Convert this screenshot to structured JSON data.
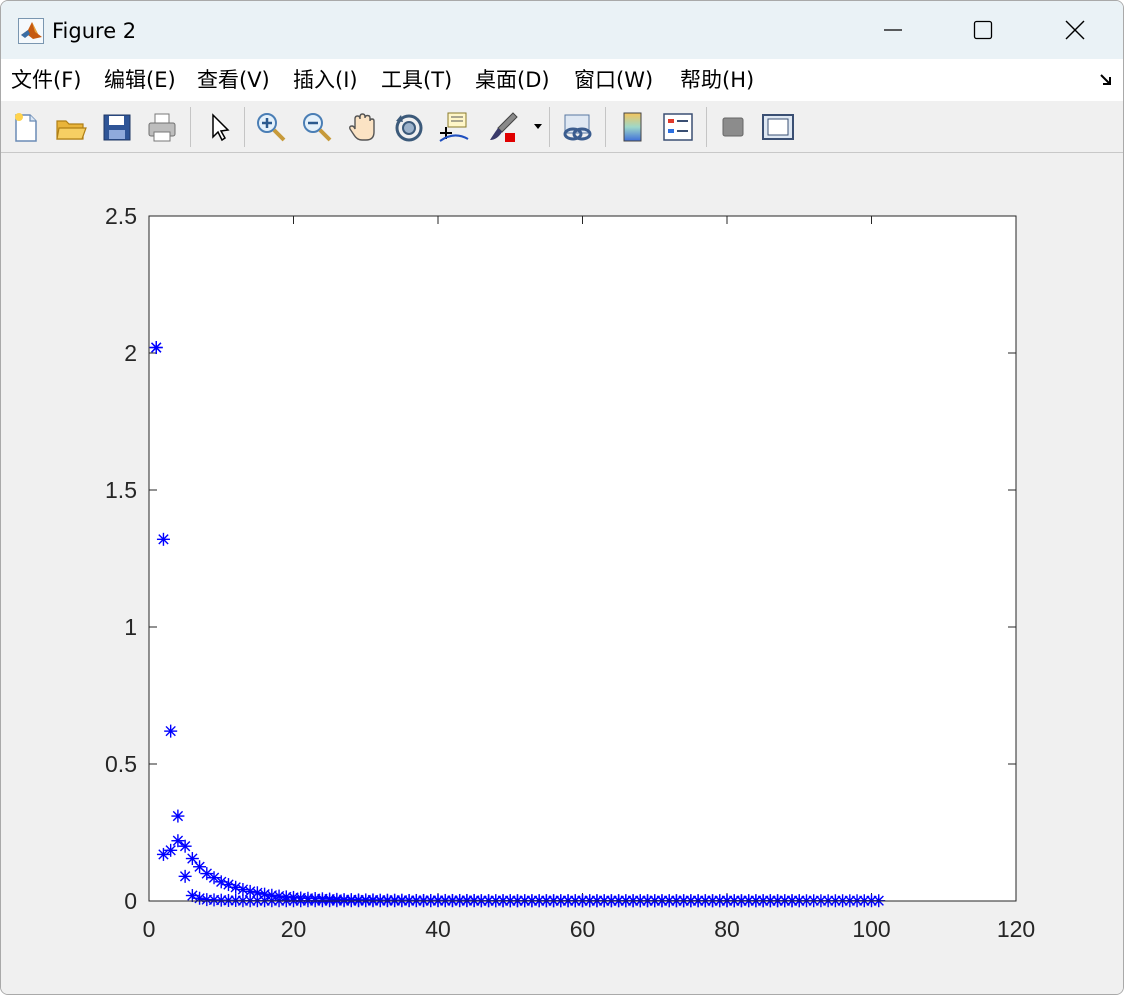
{
  "window": {
    "title": "Figure 2",
    "controls": {
      "minimize": "minimize",
      "maximize": "maximize",
      "close": "close"
    }
  },
  "menu": [
    {
      "label": "文件(F)"
    },
    {
      "label": "编辑(E)"
    },
    {
      "label": "查看(V)"
    },
    {
      "label": "插入(I)"
    },
    {
      "label": "工具(T)"
    },
    {
      "label": "桌面(D)"
    },
    {
      "label": "窗口(W)"
    },
    {
      "label": "帮助(H)"
    }
  ],
  "toolbar": {
    "icons": [
      "new-figure-icon",
      "open-file-icon",
      "save-icon",
      "print-icon",
      "edit-plot-arrow-icon",
      "zoom-in-icon",
      "zoom-out-icon",
      "pan-hand-icon",
      "rotate-3d-icon",
      "data-cursor-icon",
      "brush-icon",
      "brush-dropdown-icon",
      "link-plot-icon",
      "colorbar-icon",
      "legend-icon",
      "hide-plot-tools-icon",
      "show-plot-tools-icon"
    ]
  },
  "chart_data": {
    "type": "scatter",
    "marker": "*",
    "color": "#0000ff",
    "xlim": [
      0,
      120
    ],
    "ylim": [
      0,
      2.5
    ],
    "xticks": [
      "0",
      "20",
      "40",
      "60",
      "80",
      "100",
      "120"
    ],
    "yticks": [
      "0",
      "0.5",
      "1",
      "1.5",
      "2",
      "2.5"
    ],
    "xtick_values": [
      0,
      20,
      40,
      60,
      80,
      100,
      120
    ],
    "ytick_values": [
      0,
      0.5,
      1,
      1.5,
      2,
      2.5
    ],
    "series": [
      {
        "x": [
          1,
          2,
          3,
          4,
          5,
          6,
          7,
          8,
          9,
          10,
          11,
          12,
          13,
          14,
          15,
          16,
          17,
          18,
          19,
          20,
          21,
          22,
          23,
          24,
          25,
          26,
          27,
          28,
          29,
          30,
          31,
          32,
          33,
          34,
          35,
          36,
          37,
          38,
          39,
          40,
          41,
          42,
          43,
          44,
          45,
          46,
          47,
          48,
          49,
          50,
          51,
          52,
          53,
          54,
          55,
          56,
          57,
          58,
          59,
          60,
          61,
          62,
          63,
          64,
          65,
          66,
          67,
          68,
          69,
          70,
          71,
          72,
          73,
          74,
          75,
          76,
          77,
          78,
          79,
          80,
          81,
          82,
          83,
          84,
          85,
          86,
          87,
          88,
          89,
          90,
          91,
          92,
          93,
          94,
          95,
          96,
          97,
          98,
          99,
          100,
          101
        ],
        "y": [
          2.02,
          1.32,
          0.62,
          0.31,
          0.2,
          0.155,
          0.125,
          0.1,
          0.085,
          0.07,
          0.06,
          0.05,
          0.042,
          0.035,
          0.03,
          0.025,
          0.021,
          0.018,
          0.015,
          0.013,
          0.011,
          0.01,
          0.009,
          0.008,
          0.007,
          0.006,
          0.005,
          0.005,
          0.004,
          0.004,
          0.004,
          0.003,
          0.003,
          0.003,
          0.003,
          0.002,
          0.002,
          0.002,
          0.002,
          0.002,
          0.002,
          0.002,
          0.002,
          0.002,
          0.002,
          0.001,
          0.001,
          0.001,
          0.001,
          0.001,
          0.001,
          0.001,
          0.001,
          0.001,
          0.001,
          0.001,
          0.001,
          0.001,
          0.001,
          0.001,
          0.001,
          0.001,
          0.001,
          0.001,
          0.001,
          0.001,
          0.001,
          0.001,
          0.001,
          0.001,
          0.001,
          0.001,
          0.001,
          0.001,
          0.001,
          0.001,
          0.001,
          0.001,
          0.001,
          0.001,
          0.001,
          0.001,
          0.001,
          0.001,
          0.001,
          0.001,
          0.001,
          0.001,
          0.001,
          0.001,
          0.001,
          0.001,
          0.001,
          0.001,
          0.001,
          0.001,
          0.001,
          0.001,
          0.001,
          0.001,
          0.001
        ]
      },
      {
        "x": [
          1,
          2,
          3,
          4,
          5,
          6,
          7,
          8,
          9,
          10,
          11,
          12,
          13,
          14,
          15,
          16,
          17,
          18,
          19,
          20,
          21,
          22,
          23,
          24,
          25,
          26,
          27,
          28,
          29,
          30,
          31,
          32,
          33,
          34,
          35,
          36,
          37,
          38,
          39,
          40,
          41,
          42,
          43,
          44,
          45,
          46,
          47,
          48,
          49,
          50,
          51,
          52,
          53,
          54,
          55,
          56,
          57,
          58,
          59,
          60,
          61,
          62,
          63,
          64,
          65,
          66,
          67,
          68,
          69,
          70,
          71,
          72,
          73,
          74,
          75,
          76,
          77,
          78,
          79,
          80,
          81,
          82,
          83,
          84,
          85,
          86,
          87,
          88,
          89,
          90
        ],
        "y": [
          2.02,
          0.17,
          0.185,
          0.22,
          0.09,
          0.02,
          0.01,
          0.005,
          0.004,
          0.003,
          0.002,
          0.002,
          0.001,
          0.001,
          0.001,
          0.001,
          0.001,
          0.001,
          0.001,
          0.001,
          0.001,
          0.001,
          0.001,
          0.001,
          0.001,
          0.001,
          0.001,
          0.001,
          0.001,
          0.001,
          0.001,
          0.001,
          0.001,
          0.001,
          0.001,
          0.001,
          0.001,
          0.001,
          0.001,
          0.001,
          0.001,
          0.001,
          0.001,
          0.001,
          0.001,
          0.001,
          0.001,
          0.001,
          0.001,
          0.001,
          0.001,
          0.001,
          0.001,
          0.001,
          0.001,
          0.001,
          0.001,
          0.001,
          0.001,
          0.001,
          0.001,
          0.001,
          0.001,
          0.001,
          0.001,
          0.001,
          0.001,
          0.001,
          0.001,
          0.001,
          0.001,
          0.001,
          0.001,
          0.001,
          0.001,
          0.001,
          0.001,
          0.001,
          0.001,
          0.001,
          0.001,
          0.001,
          0.001,
          0.001,
          0.001,
          0.001,
          0.001,
          0.001,
          0.001,
          0.001
        ]
      }
    ]
  }
}
